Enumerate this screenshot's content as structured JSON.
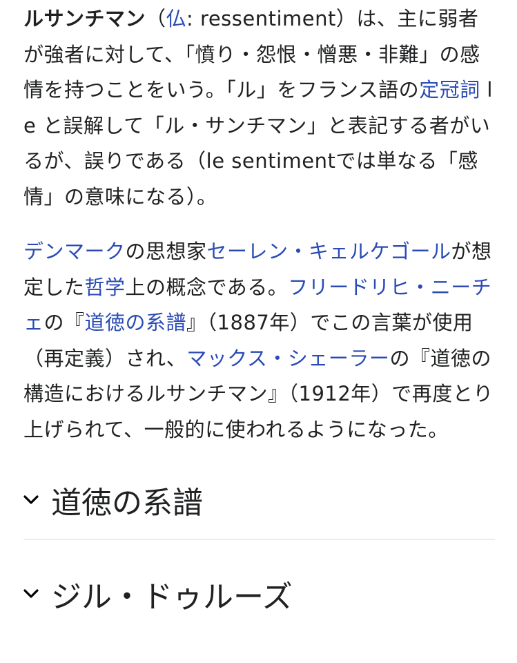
{
  "article": {
    "paragraph1": {
      "term": "ルサンチマン",
      "t1": "（",
      "link_fr": "仏",
      "t2": ": ressentiment）は、主に弱者が強者に対して、「憤り・怨恨・憎悪・非難」の感情を持つことをいう。「ル」をフランス語の",
      "link_article": "定冠詞",
      "t3": " le と誤解して「ル・サンチマン」と表記する者がいるが、誤りである（le sentimentでは単なる「感情」の意味になる）。"
    },
    "paragraph2": {
      "link_denmark": "デンマーク",
      "t1": "の思想家",
      "link_kierkegaard": "セーレン・キェルケゴール",
      "t2": "が想定した",
      "link_philosophy": "哲学",
      "t3": "上の概念である。",
      "link_nietzsche": "フリードリヒ・ニーチェ",
      "t4": "の『",
      "link_genealogy": "道徳の系譜",
      "t5": "』（1887年）でこの言葉が使用（再定義）され、",
      "link_scheler": "マックス・シェーラー",
      "t6": "の『道徳の構造におけるルサンチマン』（1912年）で再度とり上げられて、一般的に使われるようになった。"
    }
  },
  "sections": [
    {
      "title": "道徳の系譜",
      "icon": "chevron-down-icon",
      "expanded": false
    },
    {
      "title": "ジル・ドゥルーズ",
      "icon": "chevron-down-icon",
      "expanded": false
    }
  ],
  "colors": {
    "link": "#2a4bb5",
    "text": "#202122",
    "divider": "#eaecf0"
  }
}
